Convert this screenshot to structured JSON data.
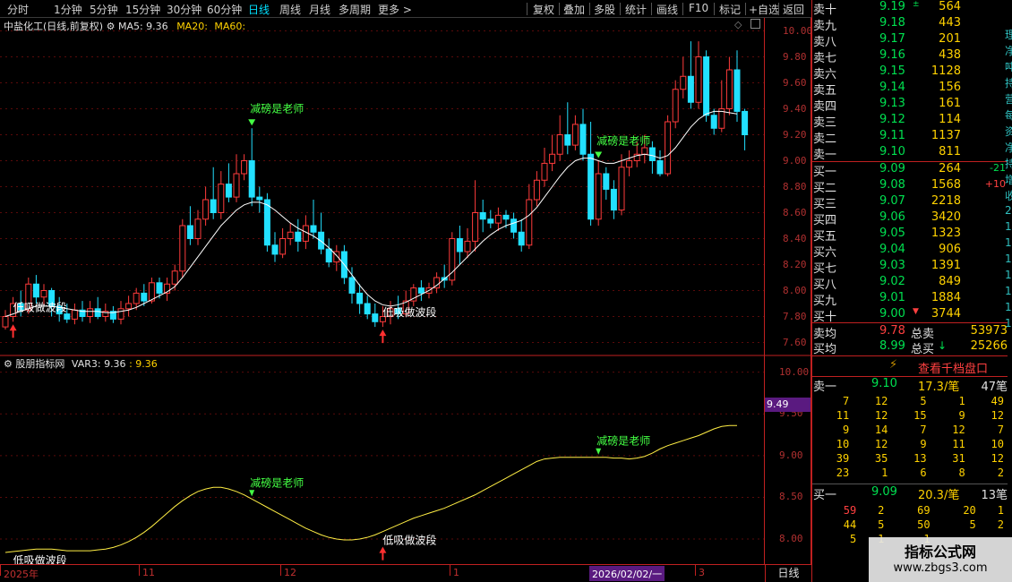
{
  "toolbar": {
    "periods": [
      "分时",
      "1分钟",
      "5分钟",
      "15分钟",
      "30分钟",
      "60分钟",
      "日线",
      "周线",
      "月线",
      "多周期",
      "更多 >"
    ],
    "active_period": "日线",
    "actions": [
      "复权",
      "叠加",
      "多股",
      "统计",
      "画线",
      "F10",
      "标记",
      "+自选",
      "返回"
    ]
  },
  "kline": {
    "stock": "中盐化工(日线,前复权)",
    "ma5_label": "MA5: 9.36",
    "ma20_label": "MA20:",
    "ma60_label": "MA60:",
    "y_ticks": [
      "10.00",
      "9.80",
      "9.60",
      "9.40",
      "9.20",
      "9.00",
      "8.80",
      "8.60",
      "8.40",
      "8.20",
      "8.00",
      "7.80",
      "7.60"
    ],
    "annotations": {
      "sell_text": "减磅是老师",
      "buy_text": "低吸做波段"
    }
  },
  "indicator": {
    "name": "股朋指标网",
    "var_label": "VAR3: 9.36",
    "var_value": ": 9.36",
    "current_tag": "9.49",
    "y_ticks": [
      "10.00",
      "9.50",
      "9.00",
      "8.50",
      "8.00"
    ]
  },
  "xaxis": {
    "labels": [
      "2025年",
      "11",
      "12",
      "1",
      "2026/02/02/一",
      "3"
    ],
    "period_button": "日线"
  },
  "orderbook": {
    "asks": [
      {
        "label": "卖十",
        "price": "9.19",
        "vol": "564",
        "mark": "±"
      },
      {
        "label": "卖九",
        "price": "9.18",
        "vol": "443"
      },
      {
        "label": "卖八",
        "price": "9.17",
        "vol": "201"
      },
      {
        "label": "卖七",
        "price": "9.16",
        "vol": "438"
      },
      {
        "label": "卖六",
        "price": "9.15",
        "vol": "1128"
      },
      {
        "label": "卖五",
        "price": "9.14",
        "vol": "156"
      },
      {
        "label": "卖四",
        "price": "9.13",
        "vol": "161"
      },
      {
        "label": "卖三",
        "price": "9.12",
        "vol": "114"
      },
      {
        "label": "卖二",
        "price": "9.11",
        "vol": "1137"
      },
      {
        "label": "卖一",
        "price": "9.10",
        "vol": "811"
      }
    ],
    "bids": [
      {
        "label": "买一",
        "price": "9.09",
        "vol": "264",
        "chg": "-21"
      },
      {
        "label": "买二",
        "price": "9.08",
        "vol": "1568",
        "chg": "+10"
      },
      {
        "label": "买三",
        "price": "9.07",
        "vol": "2218"
      },
      {
        "label": "买四",
        "price": "9.06",
        "vol": "3420"
      },
      {
        "label": "买五",
        "price": "9.05",
        "vol": "1323"
      },
      {
        "label": "买六",
        "price": "9.04",
        "vol": "906"
      },
      {
        "label": "买七",
        "price": "9.03",
        "vol": "1391"
      },
      {
        "label": "买八",
        "price": "9.02",
        "vol": "849"
      },
      {
        "label": "买九",
        "price": "9.01",
        "vol": "1884"
      },
      {
        "label": "买十",
        "price": "9.00",
        "vol": "3744",
        "mark": "▼"
      }
    ],
    "summary": [
      {
        "label": "卖均",
        "price": "9.78",
        "tlabel": "总卖",
        "total": "53973"
      },
      {
        "label": "买均",
        "price": "8.99",
        "tlabel": "总买",
        "total": "25266",
        "arrow": "↓"
      }
    ],
    "depth_button": "查看千档盘口",
    "ask1_detail": {
      "label": "卖一",
      "price": "9.10",
      "per": "17.3/笔",
      "count": "47笔"
    },
    "ask1_rows": [
      [
        "7",
        "12",
        "5",
        "1",
        "49"
      ],
      [
        "11",
        "12",
        "15",
        "9",
        "12"
      ],
      [
        "9",
        "14",
        "7",
        "12",
        "7"
      ],
      [
        "10",
        "12",
        "9",
        "11",
        "10"
      ],
      [
        "39",
        "35",
        "13",
        "31",
        "12"
      ],
      [
        "23",
        "1",
        "6",
        "8",
        "2"
      ]
    ],
    "bid1_detail": {
      "label": "买一",
      "price": "9.09",
      "per": "20.3/笔",
      "count": "13笔"
    },
    "bid1_rows": [
      [
        "59",
        "2",
        "69",
        "20",
        "1"
      ],
      [
        "44",
        "5",
        "50",
        "5",
        "2"
      ],
      [
        "5",
        "1",
        "1",
        "",
        ""
      ]
    ]
  },
  "edge_text": [
    "理",
    "净",
    "吨",
    "持",
    "营",
    "每",
    "资",
    "净",
    "持",
    "增",
    "收",
    "2",
    "1",
    "1",
    "1",
    "1",
    "1",
    "1",
    "1"
  ],
  "watermark": {
    "title": "指标公式网",
    "url": "www.zbgs3.com"
  },
  "chart_data": {
    "type": "candlestick",
    "y_range": [
      7.5,
      10.1
    ],
    "candles": [
      [
        7.72,
        7.8,
        7.7,
        7.85
      ],
      [
        7.8,
        7.9,
        7.76,
        7.95
      ],
      [
        7.9,
        7.85,
        7.8,
        8.0
      ],
      [
        7.85,
        8.05,
        7.82,
        8.1
      ],
      [
        8.05,
        7.95,
        7.9,
        8.12
      ],
      [
        7.95,
        8.0,
        7.88,
        8.05
      ],
      [
        8.0,
        7.88,
        7.8,
        8.02
      ],
      [
        7.88,
        7.82,
        7.76,
        7.95
      ],
      [
        7.82,
        7.78,
        7.75,
        7.9
      ],
      [
        7.78,
        7.85,
        7.74,
        7.9
      ],
      [
        7.85,
        7.8,
        7.76,
        7.92
      ],
      [
        7.8,
        7.86,
        7.75,
        7.92
      ],
      [
        7.86,
        7.8,
        7.78,
        7.95
      ],
      [
        7.8,
        7.84,
        7.76,
        7.9
      ],
      [
        7.84,
        7.78,
        7.75,
        7.88
      ],
      [
        7.78,
        7.86,
        7.74,
        7.92
      ],
      [
        7.86,
        7.9,
        7.8,
        7.96
      ],
      [
        7.9,
        7.98,
        7.85,
        8.02
      ],
      [
        7.98,
        7.92,
        7.88,
        8.05
      ],
      [
        7.92,
        8.06,
        7.9,
        8.1
      ],
      [
        8.06,
        7.98,
        7.94,
        8.1
      ],
      [
        7.98,
        8.05,
        7.92,
        8.1
      ],
      [
        8.05,
        8.15,
        8.0,
        8.2
      ],
      [
        8.15,
        8.5,
        8.1,
        8.55
      ],
      [
        8.5,
        8.4,
        8.35,
        8.65
      ],
      [
        8.4,
        8.55,
        8.35,
        8.62
      ],
      [
        8.55,
        8.7,
        8.5,
        8.8
      ],
      [
        8.7,
        8.6,
        8.55,
        8.95
      ],
      [
        8.6,
        8.82,
        8.55,
        8.92
      ],
      [
        8.82,
        8.72,
        8.68,
        8.98
      ],
      [
        8.72,
        8.9,
        8.68,
        9.05
      ],
      [
        8.9,
        9.0,
        8.85,
        9.05
      ],
      [
        9.0,
        8.72,
        8.65,
        9.25
      ],
      [
        8.72,
        8.7,
        8.6,
        8.8
      ],
      [
        8.7,
        8.35,
        8.3,
        8.75
      ],
      [
        8.35,
        8.28,
        8.22,
        8.45
      ],
      [
        8.28,
        8.4,
        8.25,
        8.48
      ],
      [
        8.4,
        8.45,
        8.35,
        8.52
      ],
      [
        8.45,
        8.38,
        8.3,
        8.55
      ],
      [
        8.38,
        8.5,
        8.32,
        8.58
      ],
      [
        8.5,
        8.45,
        8.4,
        8.7
      ],
      [
        8.45,
        8.32,
        8.28,
        8.6
      ],
      [
        8.32,
        8.22,
        8.18,
        8.4
      ],
      [
        8.22,
        8.3,
        8.15,
        8.35
      ],
      [
        8.3,
        8.1,
        8.05,
        8.35
      ],
      [
        8.1,
        7.98,
        7.9,
        8.18
      ],
      [
        7.98,
        7.9,
        7.82,
        8.05
      ],
      [
        7.9,
        7.82,
        7.78,
        7.96
      ],
      [
        7.82,
        7.76,
        7.72,
        7.9
      ],
      [
        7.76,
        7.8,
        7.72,
        7.88
      ],
      [
        7.8,
        7.86,
        7.74,
        7.92
      ],
      [
        7.86,
        7.82,
        7.78,
        7.96
      ],
      [
        7.82,
        7.92,
        7.8,
        8.0
      ],
      [
        7.92,
        8.02,
        7.88,
        8.05
      ],
      [
        8.02,
        7.98,
        7.92,
        8.08
      ],
      [
        7.98,
        8.02,
        7.94,
        8.06
      ],
      [
        8.02,
        8.1,
        7.98,
        8.14
      ],
      [
        8.1,
        8.08,
        8.02,
        8.2
      ],
      [
        8.08,
        8.4,
        8.04,
        8.45
      ],
      [
        8.4,
        8.3,
        8.2,
        8.5
      ],
      [
        8.3,
        8.38,
        8.25,
        8.48
      ],
      [
        8.38,
        8.6,
        8.3,
        8.85
      ],
      [
        8.6,
        8.55,
        8.45,
        8.7
      ],
      [
        8.55,
        8.52,
        8.48,
        8.62
      ],
      [
        8.52,
        8.58,
        8.46,
        8.64
      ],
      [
        8.58,
        8.55,
        8.48,
        8.62
      ],
      [
        8.55,
        8.45,
        8.4,
        8.6
      ],
      [
        8.45,
        8.35,
        8.3,
        8.55
      ],
      [
        8.35,
        8.7,
        8.32,
        8.82
      ],
      [
        8.7,
        8.85,
        8.65,
        8.92
      ],
      [
        8.85,
        8.98,
        8.8,
        9.1
      ],
      [
        8.98,
        9.05,
        8.92,
        9.2
      ],
      [
        9.05,
        9.2,
        9.0,
        9.35
      ],
      [
        9.2,
        9.12,
        9.05,
        9.45
      ],
      [
        9.12,
        9.28,
        9.08,
        9.35
      ],
      [
        9.28,
        9.05,
        9.0,
        9.4
      ],
      [
        9.05,
        8.55,
        8.5,
        9.3
      ],
      [
        8.55,
        8.9,
        8.5,
        9.0
      ],
      [
        8.9,
        8.78,
        8.7,
        8.95
      ],
      [
        8.78,
        8.62,
        8.55,
        8.85
      ],
      [
        8.62,
        8.95,
        8.58,
        9.05
      ],
      [
        8.95,
        9.0,
        8.88,
        9.08
      ],
      [
        9.0,
        9.05,
        8.95,
        9.15
      ],
      [
        9.05,
        9.1,
        8.98,
        9.2
      ],
      [
        9.1,
        9.0,
        8.9,
        9.15
      ],
      [
        9.0,
        8.9,
        8.88,
        9.08
      ],
      [
        8.9,
        9.3,
        8.88,
        9.35
      ],
      [
        9.3,
        9.55,
        9.25,
        9.62
      ],
      [
        9.55,
        9.65,
        9.48,
        9.8
      ],
      [
        9.65,
        9.45,
        9.4,
        9.92
      ],
      [
        9.45,
        9.8,
        9.4,
        9.92
      ],
      [
        9.8,
        9.35,
        9.3,
        9.85
      ],
      [
        9.35,
        9.25,
        9.2,
        9.4
      ],
      [
        9.25,
        9.4,
        9.22,
        9.62
      ],
      [
        9.4,
        9.7,
        9.35,
        9.8
      ],
      [
        9.7,
        9.38,
        9.3,
        9.85
      ],
      [
        9.38,
        9.2,
        9.08,
        9.4
      ]
    ],
    "ma5": [
      7.8,
      7.82,
      7.84,
      7.86,
      7.88,
      7.88,
      7.88,
      7.87,
      7.86,
      7.85,
      7.84,
      7.84,
      7.84,
      7.83,
      7.83,
      7.84,
      7.85,
      7.87,
      7.9,
      7.93,
      7.96,
      7.99,
      8.03,
      8.1,
      8.18,
      8.26,
      8.34,
      8.42,
      8.5,
      8.56,
      8.62,
      8.66,
      8.68,
      8.68,
      8.66,
      8.62,
      8.57,
      8.52,
      8.48,
      8.45,
      8.42,
      8.38,
      8.33,
      8.27,
      8.2,
      8.12,
      8.04,
      7.97,
      7.92,
      7.89,
      7.88,
      7.89,
      7.91,
      7.94,
      7.97,
      8.0,
      8.04,
      8.09,
      8.14,
      8.2,
      8.26,
      8.32,
      8.38,
      8.43,
      8.47,
      8.5,
      8.52,
      8.54,
      8.58,
      8.64,
      8.72,
      8.8,
      8.88,
      8.95,
      9.0,
      9.02,
      9.02,
      9.0,
      8.98,
      8.98,
      9.0,
      9.02,
      9.04,
      9.05,
      9.04,
      9.02,
      9.04,
      9.1,
      9.18,
      9.26,
      9.32,
      9.36,
      9.38,
      9.38,
      9.37,
      9.36
    ],
    "var3": [
      7.84,
      7.85,
      7.86,
      7.87,
      7.88,
      7.88,
      7.88,
      7.87,
      7.86,
      7.86,
      7.86,
      7.86,
      7.87,
      7.88,
      7.9,
      7.93,
      7.97,
      8.02,
      8.08,
      8.15,
      8.23,
      8.31,
      8.39,
      8.46,
      8.52,
      8.57,
      8.6,
      8.62,
      8.62,
      8.6,
      8.57,
      8.53,
      8.48,
      8.43,
      8.38,
      8.33,
      8.28,
      8.23,
      8.18,
      8.13,
      8.09,
      8.05,
      8.02,
      8.0,
      7.99,
      7.99,
      8.0,
      8.02,
      8.05,
      8.09,
      8.13,
      8.17,
      8.21,
      8.25,
      8.28,
      8.31,
      8.34,
      8.37,
      8.41,
      8.45,
      8.49,
      8.53,
      8.58,
      8.63,
      8.68,
      8.73,
      8.78,
      8.83,
      8.88,
      8.93,
      8.96,
      8.97,
      8.98,
      8.98,
      8.98,
      8.98,
      8.98,
      8.98,
      8.98,
      8.97,
      8.97,
      8.96,
      8.97,
      8.99,
      9.03,
      9.08,
      9.12,
      9.15,
      9.18,
      9.21,
      9.24,
      9.28,
      9.32,
      9.35,
      9.36,
      9.36
    ],
    "sell_signal_index": [
      32,
      77
    ],
    "buy_signal_index": [
      1,
      49
    ]
  }
}
